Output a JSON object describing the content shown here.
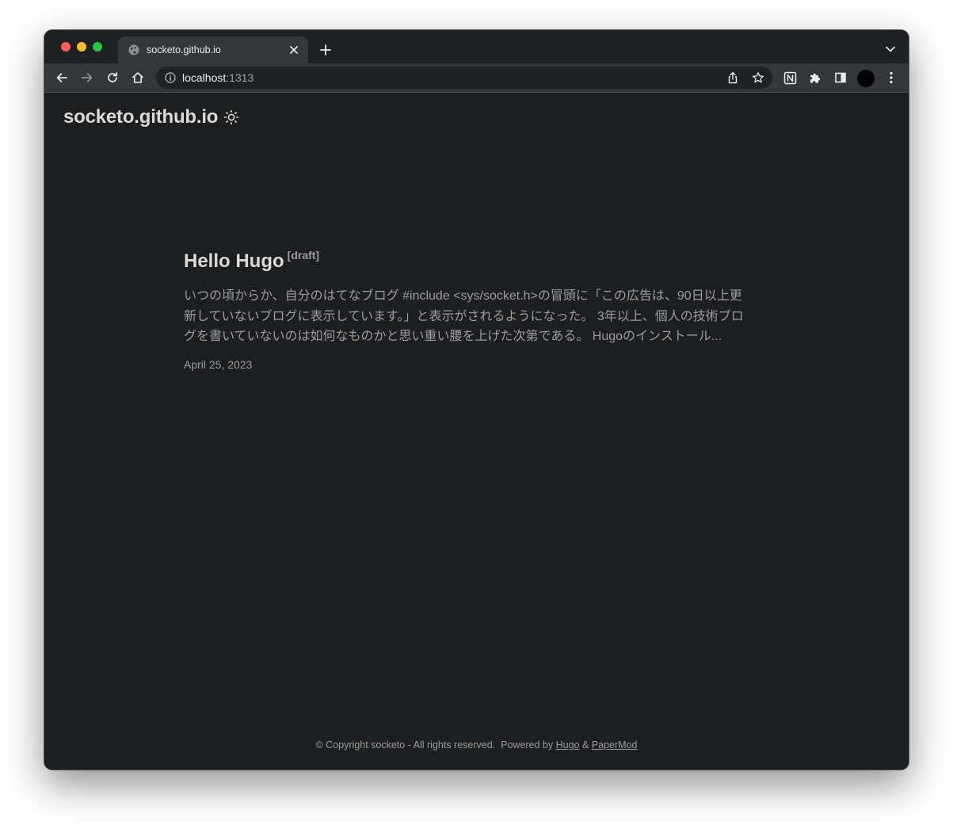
{
  "browser": {
    "tab": {
      "title": "socketo.github.io"
    },
    "omnibox": {
      "host": "localhost",
      "port": ":1313"
    },
    "icons": {
      "back": "arrow-left-icon",
      "forward": "arrow-right-icon",
      "reload": "reload-icon",
      "home": "home-icon",
      "info": "info-icon",
      "share": "share-icon",
      "star": "star-icon",
      "notion": "notion-icon",
      "extensions": "puzzle-icon",
      "sidepanel": "side-panel-icon",
      "menu": "kebab-menu-icon"
    }
  },
  "site": {
    "logo": "socketo.github.io",
    "theme_toggle_icon": "sun-icon"
  },
  "post": {
    "title": "Hello Hugo",
    "draft_label": "[draft]",
    "summary": "いつの頃からか、自分のはてなブログ #include <sys/socket.h>の冒頭に「この広告は、90日以上更新していないブログに表示しています。」と表示がされるようになった。 3年以上、個人の技術ブログを書いていないのは如何なものかと思い重い腰を上げた次第である。 Hugoのインストール...",
    "date": "April 25, 2023"
  },
  "footer": {
    "copyright": "© Copyright socketo - All rights reserved.",
    "powered_by": "Powered by",
    "hugo_link": "Hugo",
    "amp": "&",
    "papermod_link": "PaperMod"
  },
  "colors": {
    "page_bg": "#1d1e20",
    "primary_text": "#dadadb",
    "secondary_text": "#9b9c9d",
    "toolbar_bg": "#35363a",
    "tabstrip_bg": "#1f2023"
  }
}
